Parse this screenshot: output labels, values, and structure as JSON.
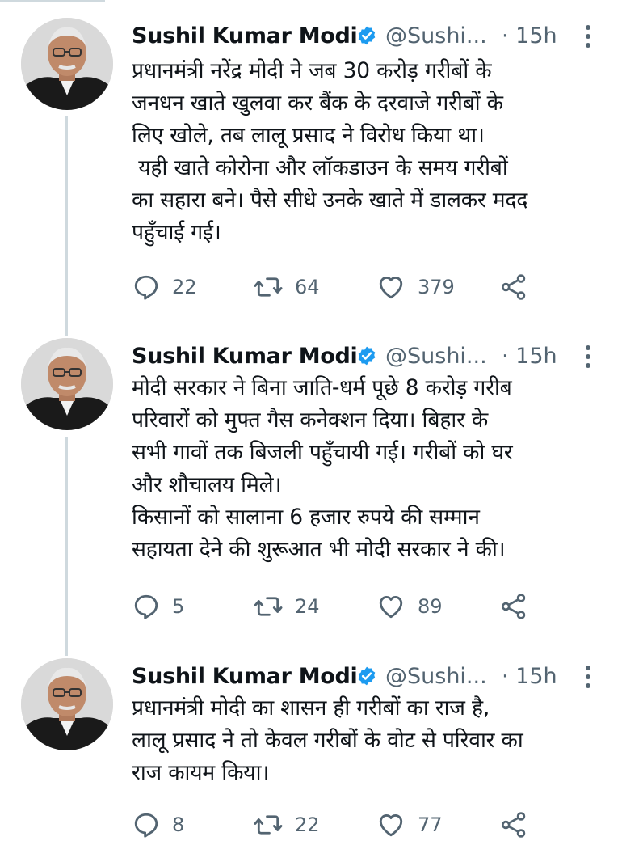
{
  "tweets": [
    {
      "author": "Sushil Kumar Modi",
      "handle": "@Sushi...",
      "time": "· 15h",
      "text": "प्रधानमंत्री नरेंद्र मोदी ने जब 30 करोड़ गरीबों के\nजनधन खाते खुलवा कर बैंक के दरवाजे गरीबों के\nलिए खोले, तब लालू प्रसाद ने विरोध किया था।\n यही खाते कोरोना और लॉकडाउन के समय गरीबों\nका सहारा बने। पैसे सीधे उनके खाते में डालकर मदद\nपहुँचाई गई।",
      "replies": "22",
      "retweets": "64",
      "likes": "379"
    },
    {
      "author": "Sushil Kumar Modi",
      "handle": "@Sushi...",
      "time": "· 15h",
      "text": "मोदी सरकार ने बिना जाति-धर्म पूछे 8 करोड़ गरीब\nपरिवारों को मुफ्त गैस कनेक्शन दिया। बिहार के\nसभी गावों तक बिजली पहुँचायी गई। गरीबों को घर\nऔर शौचालय मिले।\nकिसानों को सालाना 6 हजार रुपये की सम्मान\nसहायता देने की शुरूआत भी मोदी सरकार ने की।",
      "replies": "5",
      "retweets": "24",
      "likes": "89"
    },
    {
      "author": "Sushil Kumar Modi",
      "handle": "@Sushi...",
      "time": "· 15h",
      "text": "प्रधानमंत्री मोदी का शासन ही गरीबों का राज है,\nलालू प्रसाद ने तो केवल गरीबों के वोट से परिवार का\nराज कायम किया।",
      "replies": "8",
      "retweets": "22",
      "likes": "77"
    }
  ],
  "colors": {
    "verified": "#1d9bf0",
    "secondary_text": "#536471",
    "thread_line": "#cfd9de"
  },
  "icons": [
    "verified-badge-icon",
    "more-options-icon",
    "reply-icon",
    "retweet-icon",
    "like-icon",
    "share-icon"
  ]
}
